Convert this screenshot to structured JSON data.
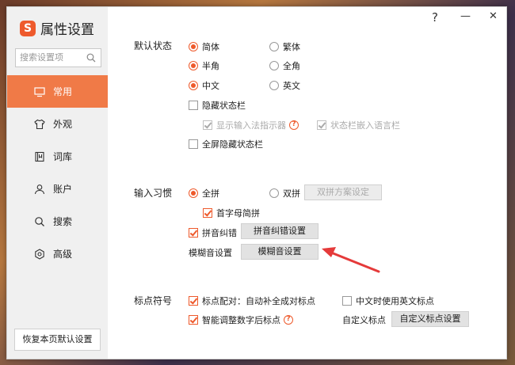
{
  "app": {
    "title": "属性设置",
    "logo_letter": "S",
    "brand_color": "#ee5a2c"
  },
  "titlebar": {
    "help": "?",
    "minimize": "—",
    "close": "✕"
  },
  "search": {
    "placeholder": "搜索设置项",
    "icon": "search-icon"
  },
  "sidebar": {
    "items": [
      {
        "label": "常用",
        "icon": "monitor-icon",
        "active": true
      },
      {
        "label": "外观",
        "icon": "shirt-icon"
      },
      {
        "label": "词库",
        "icon": "book-icon"
      },
      {
        "label": "账户",
        "icon": "user-icon"
      },
      {
        "label": "搜索",
        "icon": "search-icon"
      },
      {
        "label": "高级",
        "icon": "gear-icon"
      }
    ],
    "reset_label": "恢复本页默认设置"
  },
  "default_state": {
    "label": "默认状态",
    "simplified": "简体",
    "traditional": "繁体",
    "half_width": "半角",
    "full_width": "全角",
    "chinese": "中文",
    "english": "英文",
    "hide_status_bar": "隐藏状态栏",
    "show_indicator": "显示输入法指示器",
    "embed_lang_bar": "状态栏嵌入语言栏",
    "fullscreen_hide": "全屏隐藏状态栏"
  },
  "input_habit": {
    "label": "输入习惯",
    "full_pinyin": "全拼",
    "double_pinyin": "双拼",
    "double_scheme_btn": "双拼方案设定",
    "initial_abbrev": "首字母简拼",
    "pinyin_correct": "拼音纠错",
    "pinyin_correct_btn": "拼音纠错设置",
    "fuzzy_label": "模糊音设置",
    "fuzzy_btn": "模糊音设置"
  },
  "punctuation": {
    "label": "标点符号",
    "auto_pair": "标点配对：自动补全成对标点",
    "english_in_chinese": "中文时使用英文标点",
    "smart_adjust": "智能调整数字后标点",
    "custom_label": "自定义标点",
    "custom_btn": "自定义标点设置"
  },
  "help_glyph": "?"
}
